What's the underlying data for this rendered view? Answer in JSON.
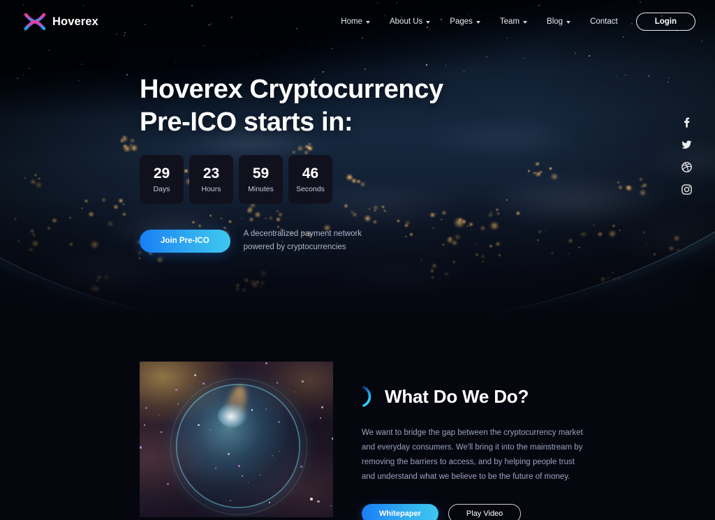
{
  "brand": {
    "name": "Hoverex",
    "logo_icon": "x-logo-icon"
  },
  "nav": {
    "items": [
      {
        "label": "Home",
        "has_dropdown": true
      },
      {
        "label": "About Us",
        "has_dropdown": true
      },
      {
        "label": "Pages",
        "has_dropdown": true
      },
      {
        "label": "Team",
        "has_dropdown": true
      },
      {
        "label": "Blog",
        "has_dropdown": true
      },
      {
        "label": "Contact",
        "has_dropdown": false
      }
    ],
    "login_label": "Login"
  },
  "hero": {
    "title_line1": "Hoverex Cryptocurrency",
    "title_line2": "Pre-ICO starts in:",
    "countdown": [
      {
        "value": "29",
        "label": "Days"
      },
      {
        "value": "23",
        "label": "Hours"
      },
      {
        "value": "59",
        "label": "Minutes"
      },
      {
        "value": "46",
        "label": "Seconds"
      }
    ],
    "cta_label": "Join Pre-ICO",
    "subtext": "A decentralized payment network powered by cryptocurrencies",
    "background": "earth-from-space-at-night"
  },
  "social": {
    "items": [
      {
        "name": "facebook-icon"
      },
      {
        "name": "twitter-icon"
      },
      {
        "name": "dribbble-icon"
      },
      {
        "name": "instagram-icon"
      }
    ]
  },
  "about": {
    "image_alt": "bubble-nebula-image",
    "icon": "crescent-icon",
    "title": "What Do We Do?",
    "body": "We want to bridge the gap between the cryptocurrency market and everyday consumers. We'll bring it into the mainstream by removing the barriers to access, and by helping people trust and understand what we believe to be the future of money.",
    "whitepaper_label": "Whitepaper",
    "play_video_label": "Play Video"
  },
  "colors": {
    "accent_blue": "#1a7ef5",
    "accent_cyan": "#3ec8f0",
    "page_bg": "#05060e",
    "card_bg": "#11111e",
    "text_muted": "#9aa2be",
    "logo_pink": "#f0389a",
    "logo_blue": "#1e9bf0"
  }
}
